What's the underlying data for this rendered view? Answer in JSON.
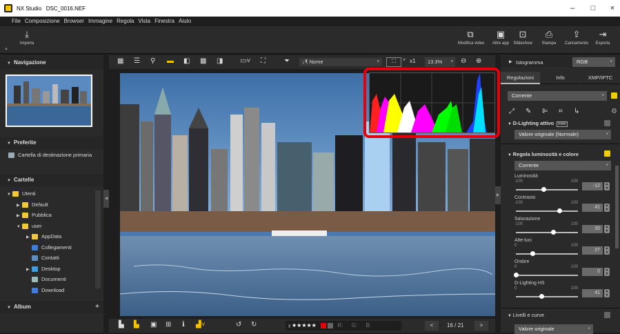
{
  "window": {
    "app_name": "NX Studio",
    "file_name": "DSC_0016.NEF"
  },
  "menu": [
    "File",
    "Composizione",
    "Browser",
    "Immagine",
    "Regola",
    "Vista",
    "Finestra",
    "Aiuto"
  ],
  "toolbar": {
    "import_label": "Importa",
    "right_items": [
      "Modifica video",
      "Altre app",
      "Slideshow",
      "Stampa",
      "Caricamento",
      "Esporta"
    ]
  },
  "left": {
    "navigation_title": "Navigazione",
    "favorites_title": "Preferite",
    "favorite_item": "Cartella di destinazione primaria",
    "folders_title": "Cartelle",
    "tree": [
      "Utenti",
      "Default",
      "Pubblica",
      "user",
      "AppData",
      "Collegamenti",
      "Contatti",
      "Desktop",
      "Documenti",
      "Download"
    ],
    "album_title": "Album",
    "album_add": "+"
  },
  "viewbar": {
    "sort_label": "Nome",
    "zoom_multiplier": "x1",
    "zoom_percent": "13.3%"
  },
  "bottombar": {
    "r_label": "R:",
    "g_label": "G:",
    "b_label": "B:",
    "page_counter": "16 / 21",
    "rating": "★★★★★"
  },
  "right": {
    "histogram_label": "Istogramma",
    "histogram_mode": "RGB",
    "tabs": [
      "Regolazioni",
      "Info",
      "XMP/IPTC"
    ],
    "preset": "Corrente",
    "dlighting_title": "D-Lighting attivo",
    "raw_badge": "RAW",
    "dlighting_value": "Valore originale (Normale)",
    "brightness_title": "Regola luminosità e colore",
    "brightness_preset": "Corrente",
    "sliders": [
      {
        "label": "Luminosità",
        "min": "-100",
        "max": "100",
        "value": "-12",
        "fraction": 0.44
      },
      {
        "label": "Contrasto",
        "min": "-100",
        "max": "100",
        "value": "41",
        "fraction": 0.7
      },
      {
        "label": "Saturazione",
        "min": "-100",
        "max": "100",
        "value": "20",
        "fraction": 0.6
      },
      {
        "label": "Alte-luci",
        "min": "0",
        "max": "100",
        "value": "27",
        "fraction": 0.27
      },
      {
        "label": "Ombre",
        "min": "0",
        "max": "100",
        "value": "0",
        "fraction": 0.0
      },
      {
        "label": "D-Lighting HS",
        "min": "0",
        "max": "100",
        "value": "41",
        "fraction": 0.41
      }
    ],
    "levels_title": "Livelli e curve",
    "levels_value": "Valore originale"
  },
  "colors": {
    "accent_yellow": "#f5c400",
    "highlight_red": "#e5000a",
    "checkbox_yellow": "#f0d000"
  }
}
